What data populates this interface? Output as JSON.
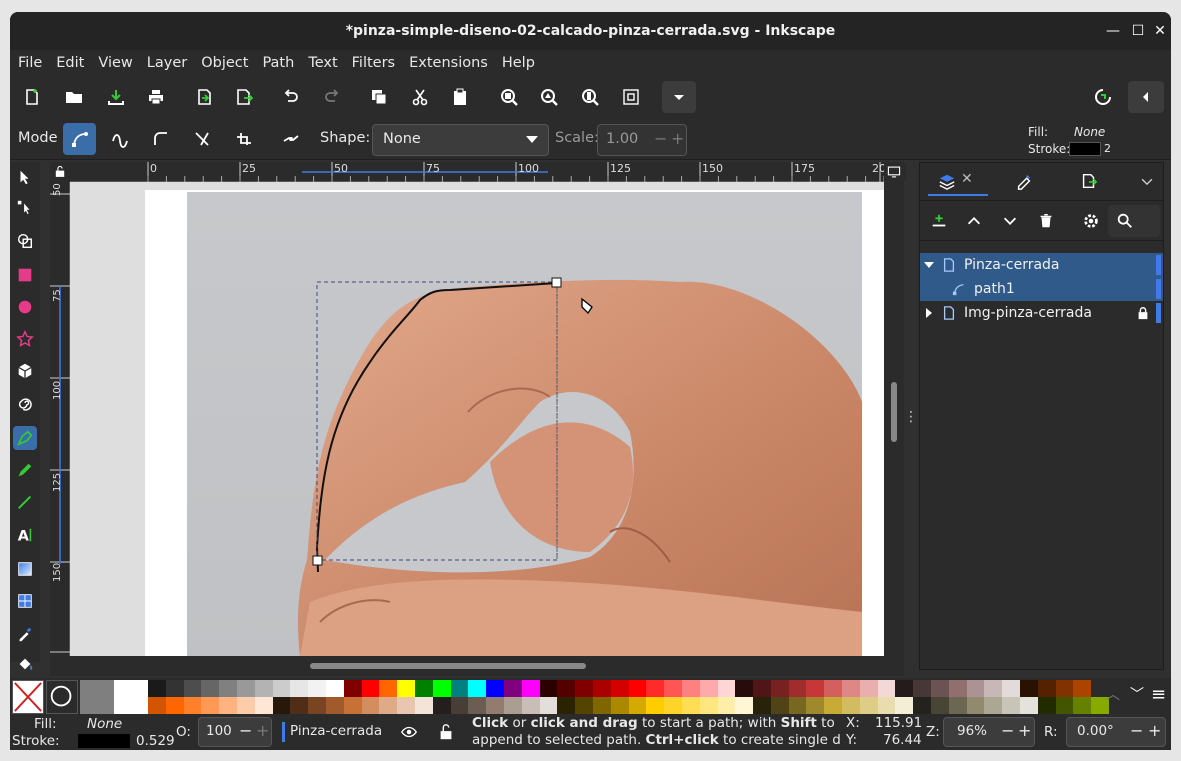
{
  "window": {
    "title": "*pinza-simple-diseno-02-calcado-pinza-cerrada.svg - Inkscape"
  },
  "menu": [
    "File",
    "Edit",
    "View",
    "Layer",
    "Object",
    "Path",
    "Text",
    "Filters",
    "Extensions",
    "Help"
  ],
  "tool_controls": {
    "mode_label": "Mode",
    "shape_label": "Shape:",
    "shape_value": "None",
    "scale_label": "Scale:",
    "scale_value": "1.00"
  },
  "style_indicator": {
    "fill_label": "Fill:",
    "fill_value": "None",
    "stroke_label": "Stroke:",
    "stroke_width": "2"
  },
  "ruler": {
    "h_ticks": [
      "0",
      "25",
      "50",
      "75",
      "100",
      "125",
      "150",
      "175",
      "20"
    ],
    "v_ticks": [
      "50",
      "75",
      "100",
      "125",
      "150",
      "75"
    ]
  },
  "layers": [
    {
      "name": "Pinza-cerrada",
      "expanded": true,
      "selected": true
    },
    {
      "name": "path1",
      "child": true,
      "selected": true
    },
    {
      "name": "Img-pinza-cerrada",
      "expanded": false,
      "locked": true
    }
  ],
  "status": {
    "fill_label": "Fill:",
    "fill_value": "None",
    "stroke_label": "Stroke:",
    "stroke_width": "0.529",
    "opacity_label": "O:",
    "opacity_value": "100",
    "layer_name": "Pinza-cerrada",
    "message_line1_parts": [
      "Click",
      " or ",
      "click and drag",
      " to start a path; with ",
      "Shift",
      " to"
    ],
    "message_line2_parts": [
      "append to selected path. ",
      "Ctrl+click",
      " to create single d..."
    ],
    "x_label": "X:",
    "x_value": "115.91",
    "y_label": "Y:",
    "y_value": "76.44",
    "zoom_label": "Z:",
    "zoom_value": "96%",
    "rotation_label": "R:",
    "rotation_value": "0.00°"
  },
  "colors": {
    "accent": "#3e7be8",
    "selection_row": "#2f5a8a",
    "tool_active": "#3b6ea8",
    "palette_row1": [
      "#1a1a1a",
      "#333333",
      "#4d4d4d",
      "#666666",
      "#808080",
      "#999999",
      "#b3b3b3",
      "#cccccc",
      "#e6e6e6",
      "#f2f2f2",
      "#ffffff",
      "#800000",
      "#ff0000",
      "#ff6600",
      "#ffff00",
      "#008000",
      "#00ff00",
      "#008080",
      "#00ffff",
      "#0000ff",
      "#800080",
      "#ff00ff",
      "#2b0000",
      "#550000",
      "#800000",
      "#aa0000",
      "#d40000",
      "#ff0000",
      "#ff2a2a",
      "#ff5555",
      "#ff8080",
      "#ffaaaa",
      "#ffd5d5",
      "#280b0b",
      "#501616",
      "#782121",
      "#a02c2c",
      "#c83737",
      "#d35f5f",
      "#de8787",
      "#e9afaf",
      "#f4d7d7",
      "#241c1c",
      "#483737",
      "#6c5353",
      "#916f6f",
      "#ac9393",
      "#c8b7b7",
      "#e3dbdb",
      "#2b1100",
      "#552200",
      "#803300",
      "#aa4400"
    ],
    "palette_row2": [
      "#d45500",
      "#ff6600",
      "#ff7f2a",
      "#ff9955",
      "#ffb380",
      "#ffccaa",
      "#ffe6d5",
      "#28170b",
      "#502d16",
      "#784421",
      "#a05a2c",
      "#c87137",
      "#d38d5f",
      "#deaa87",
      "#e9c6af",
      "#f4e3d7",
      "#241f1c",
      "#483e37",
      "#6c5d53",
      "#917c6f",
      "#ac9d93",
      "#c8beb7",
      "#e3dedb",
      "#2b2200",
      "#554400",
      "#806600",
      "#aa8800",
      "#d4aa00",
      "#ffcc00",
      "#ffd42a",
      "#ffdd55",
      "#ffe680",
      "#ffeeaa",
      "#fff6d5",
      "#28220b",
      "#504416",
      "#786721",
      "#a0892c",
      "#c8ab37",
      "#d3bc5f",
      "#decd87",
      "#e9ddaf",
      "#f4eed7",
      "#24221c",
      "#484537",
      "#6c6753",
      "#918a6f",
      "#aca793",
      "#c8c4b7",
      "#e3e2db",
      "#222b00",
      "#445500",
      "#668000",
      "#88aa00"
    ]
  }
}
